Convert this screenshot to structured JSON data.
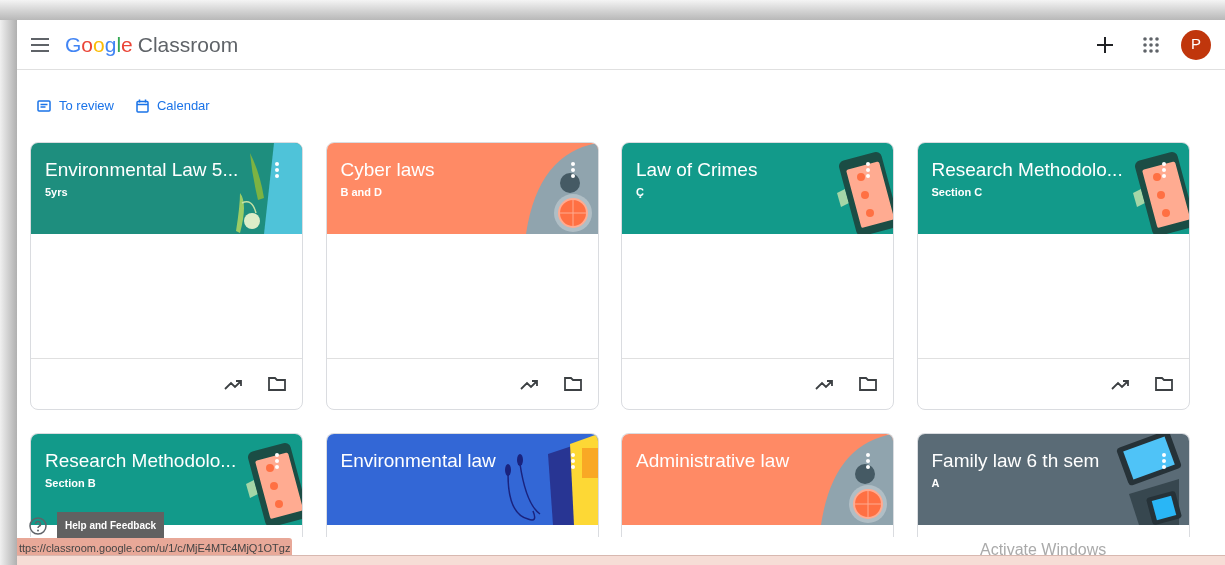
{
  "header": {
    "brand_google": "Google",
    "brand_product": "Classroom",
    "avatar_letter": "P"
  },
  "links": [
    {
      "kind": "review",
      "label": "To review"
    },
    {
      "kind": "calendar",
      "label": "Calendar"
    }
  ],
  "cards": [
    {
      "title": "Environmental Law 5...",
      "section": "5yrs",
      "color": "#1e8e7e",
      "kind": "peas",
      "footer": true
    },
    {
      "title": "Cyber laws",
      "section": "B and D",
      "color": "#ff8a65",
      "kind": "bowl",
      "footer": true
    },
    {
      "title": "Law of Crimes",
      "section": "Ç",
      "color": "#129a8a",
      "kind": "phone",
      "footer": true
    },
    {
      "title": "Research Methodolo...",
      "section": "Section C",
      "color": "#129a8a",
      "kind": "phone",
      "footer": true
    },
    {
      "title": "Research Methodolo...",
      "section": "Section B",
      "color": "#129a8a",
      "kind": "phone",
      "footer": false
    },
    {
      "title": "Environmental law",
      "color": "#3367d6",
      "kind": "headphones",
      "footer": false
    },
    {
      "title": "Administrative law",
      "color": "#ff8a65",
      "kind": "bowl",
      "footer": false
    },
    {
      "title": "Family law 6 th sem",
      "section": "A",
      "color": "#5a6b76",
      "kind": "tablet",
      "footer": false
    }
  ],
  "help": {
    "tooltip": "Help and Feedback"
  },
  "status_url": "ttps://classroom.google.com/u/1/c/MjE4MTc4MjQ1OTgz",
  "os_notice": "Activate Windows"
}
